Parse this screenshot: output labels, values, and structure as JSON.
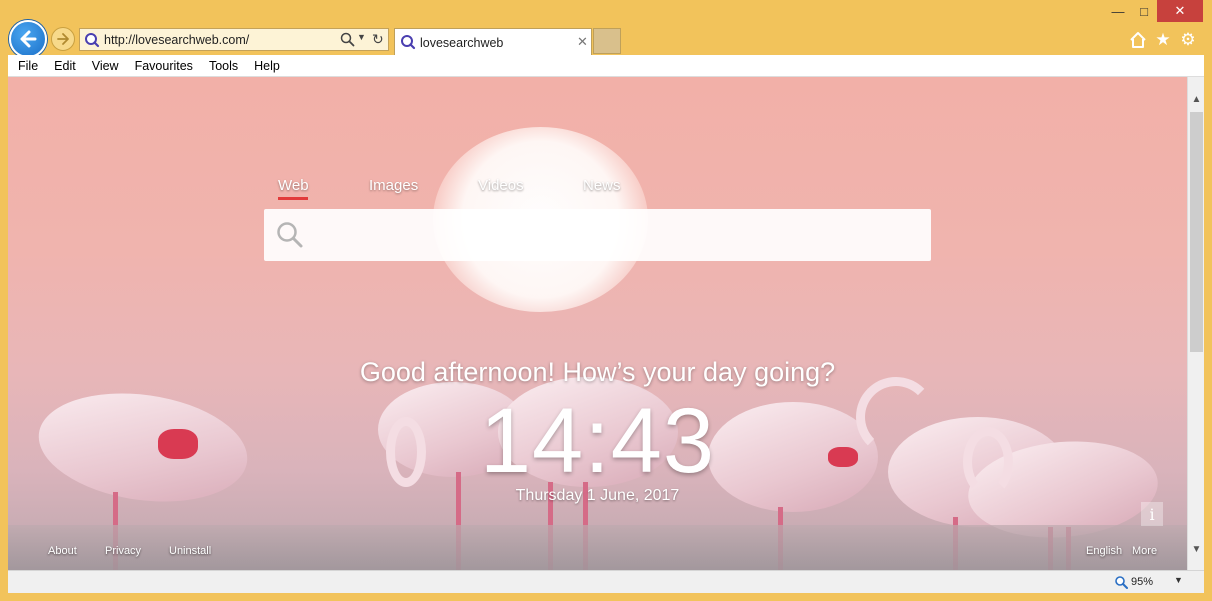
{
  "browser": {
    "address_url": "http://lovesearchweb.com/",
    "tab_title": "lovesearchweb",
    "menu": [
      "File",
      "Edit",
      "View",
      "Favourites",
      "Tools",
      "Help"
    ],
    "zoom": "95%"
  },
  "search": {
    "tabs": [
      "Web",
      "Images",
      "Videos",
      "News"
    ],
    "active_tab": "Web",
    "placeholder": ""
  },
  "greeting": "Good afternoon! How’s your day going?",
  "clock": "14:43",
  "date": "Thursday 1 June, 2017",
  "footer": {
    "left": [
      "About",
      "Privacy",
      "Uninstall"
    ],
    "right": [
      "English",
      "More"
    ]
  },
  "colors": {
    "frame": "#f2c35b",
    "tab_underline": "#e23b3b",
    "close_button": "#c7413d"
  }
}
